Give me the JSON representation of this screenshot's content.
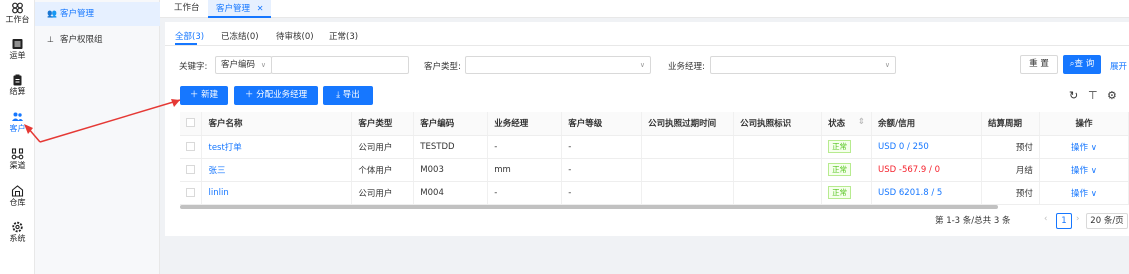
{
  "nav": [
    {
      "label": "工作台",
      "icon": "workbench-icon"
    },
    {
      "label": "运单",
      "icon": "waybill-icon"
    },
    {
      "label": "结算",
      "icon": "settlement-icon"
    },
    {
      "label": "客户",
      "icon": "customer-icon"
    },
    {
      "label": "渠道",
      "icon": "channel-icon"
    },
    {
      "label": "仓库",
      "icon": "warehouse-icon"
    },
    {
      "label": "系统",
      "icon": "system-icon"
    }
  ],
  "submenu": [
    {
      "label": "客户管理"
    },
    {
      "label": "客户权限组"
    }
  ],
  "tabs": [
    {
      "label": "工作台"
    },
    {
      "label": "客户管理",
      "close": "✕"
    }
  ],
  "status_tabs": [
    {
      "label": "全部(3)"
    },
    {
      "label": "已冻结(0)"
    },
    {
      "label": "待审核(0)"
    },
    {
      "label": "正常(3)"
    }
  ],
  "filters": {
    "keyword_label": "关键字:",
    "keyword_select": "客户编码",
    "type_label": "客户类型:",
    "manager_label": "业务经理:",
    "reset": "重 置",
    "query": "查 询",
    "expand": "展开"
  },
  "actions": {
    "new": "新建",
    "assign": "分配业务经理",
    "export": "导出"
  },
  "table": {
    "columns": [
      "客户名称",
      "客户类型",
      "客户编码",
      "业务经理",
      "客户等级",
      "公司执照过期时间",
      "公司执照标识",
      "状态",
      "余额/信用",
      "结算周期",
      "操作"
    ],
    "rows": [
      {
        "name": "test打单",
        "type": "公司用户",
        "code": "TESTDD",
        "manager": "-",
        "level": "-",
        "expiry": "",
        "license": "",
        "status": "正常",
        "balance": "USD 0 / 250",
        "cycle": "预付",
        "op": "操作"
      },
      {
        "name": "张三",
        "type": "个体用户",
        "code": "M003",
        "manager": "mm",
        "level": "-",
        "expiry": "",
        "license": "",
        "status": "正常",
        "balance": "USD -567.9 / 0",
        "cycle": "月结",
        "op": "操作"
      },
      {
        "name": "linlin",
        "type": "公司用户",
        "code": "M004",
        "manager": "-",
        "level": "-",
        "expiry": "",
        "license": "",
        "status": "正常",
        "balance": "USD 6201.8 / 5",
        "cycle": "预付",
        "op": "操作"
      }
    ]
  },
  "pagination": {
    "summary": "第 1-3 条/总共 3 条",
    "page": "1",
    "size": "20 条/页"
  },
  "colors": {
    "accent": "#1677ff",
    "arrow": "#e53935",
    "success": "#52c41a",
    "danger": "#f5222d"
  }
}
